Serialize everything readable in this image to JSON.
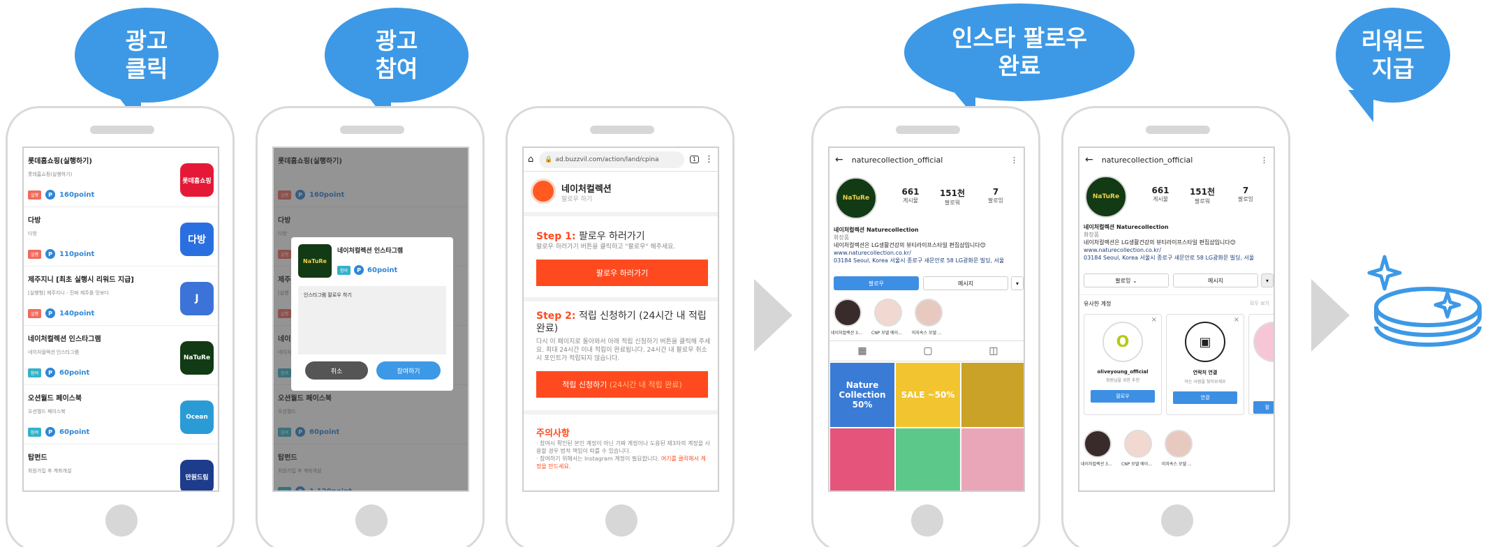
{
  "bubbles": [
    {
      "text": "광고\n클릭"
    },
    {
      "text": "광고\n참여"
    },
    {
      "text": "인스타 팔로우\n완료"
    },
    {
      "text": "리워드\n지급"
    }
  ],
  "colors": {
    "accent": "#3d99e6",
    "orange": "#ff4a1f",
    "point": "#2f86d6",
    "tag_red": "#f06b5d",
    "tag_teal": "#35b1c9"
  },
  "ad_list": [
    {
      "title": "롯데홈쇼핑(실행하기)",
      "sub": "롯데홈쇼핑(실행하기)",
      "tag": "실행",
      "points": "160point",
      "icon_text": "롯데홈쇼핑",
      "icon_color": "#e51937"
    },
    {
      "title": "다방",
      "sub": "다방",
      "tag": "실행",
      "points": "110point",
      "icon_text": "다방",
      "icon_color": "#2a6fe0"
    },
    {
      "title": "제주지니 [최초 실행시 리워드 지급]",
      "sub": "[실행형] 제주지니 - 진짜 제주를 맛보다",
      "tag": "실행",
      "points": "140point",
      "icon_text": "J",
      "icon_color": "#3b73d9"
    },
    {
      "title": "네이처컬렉션 인스타그램",
      "sub": "네이처컬렉션 인스타그램",
      "tag": "참여",
      "points": "60point",
      "icon_text": "NaTuRe",
      "icon_color": "#123a14"
    },
    {
      "title": "오션월드 페이스북",
      "sub": "오션월드 페이스북",
      "tag": "참여",
      "points": "60point",
      "icon_text": "Ocean",
      "icon_color": "#2b9bd6"
    },
    {
      "title": "탑펀드",
      "sub": "회원가입 후 계좌개설",
      "tag": "",
      "points": "",
      "icon_text": "만원드림",
      "icon_color": "#1e3c8c"
    }
  ],
  "phone2": {
    "rows": [
      {
        "title": "롯데홈쇼핑(실행하기)",
        "tag": "실행",
        "points": "160point"
      },
      {
        "title": "다방",
        "sub": "다방",
        "tag": "실행",
        "points": "110point"
      },
      {
        "title": "제주지니",
        "sub": "[실행",
        "tag": "실행",
        "points": "140point"
      },
      {
        "title": "네이처",
        "sub": "네이처",
        "tag": "참여",
        "points": "60point"
      },
      {
        "title": "오션월드 페이스북",
        "sub": "오션월드",
        "tag": "참여",
        "points": "60point"
      },
      {
        "title": "탑펀드",
        "sub": "회원가입 후 계좌개설",
        "tag": "참여",
        "points": "1,120point"
      }
    ],
    "dialog": {
      "title": "네이처컬렉션 인스타그램",
      "tag": "참여",
      "points": "60point",
      "body": "인스타그램 팔로우 하기",
      "cancel": "취소",
      "confirm": "참여하기"
    }
  },
  "phone3": {
    "url": "ad.buzzvil.com/action/land/cpina",
    "tab_count": "1",
    "brand": "네이처컬렉션",
    "brand_sub": "팔로우 하기",
    "step1_label": "Step 1:",
    "step1_title": "팔로우 하러가기",
    "step1_desc": "팔로우 하러가기 버튼을 클릭하고 \"팔로우\" 해주세요.",
    "step1_btn": "팔로우 하러가기",
    "step2_label": "Step 2:",
    "step2_title": "적립 신청하기 (24시간 내 적립 완료)",
    "step2_desc": "다시 이 페이지로 돌아와서 아래 적립 신청하기 버튼을 클릭해 주세요. 최대 24시간 이내 적립이 완료됩니다. 24시간 내 팔로우 취소시 포인트가 적립되지 않습니다.",
    "step2_btn": "적립 신청하기",
    "step2_btn_hint": "(24시간 내 적립 완료)",
    "notice_title": "주의사항",
    "notice_text": "· 참여시 확인된 본인 계정이 아닌 가짜 계정이나 도용된 제3자의 계정을 사용할 경우 법적 책임이 따를 수 있습니다.\n· 참여하기 위해서는 Instagram 계정이 필요합니다.",
    "notice_link": "여기를 클릭해서 계정을 만드세요."
  },
  "ig": {
    "username": "naturecollection_official",
    "avatar_text": "NaTuRe",
    "posts": "661",
    "posts_label": "게시물",
    "followers": "151천",
    "followers_label": "팔로워",
    "following": "7",
    "following_label": "팔로잉",
    "bio_name": "네이처컬렉션 Naturecollection",
    "bio_cat": "화장품",
    "bio_desc": "네이처컬렉션은 LG생활건강의 뷰티라이프스타일 편집샵입니다😊",
    "bio_link": "www.naturecollection.co.kr/",
    "bio_addr": "03184 Seoul, Korea 서울시 종로구 새문안로 58 LG광화문 빌딩, 서울",
    "follow_btn": "팔로우",
    "message_btn": "메시지",
    "stories": [
      "네이처컬렉션 3...",
      "CNP 모델 에이...",
      "미자속스 모델 ..."
    ],
    "tiles": [
      {
        "text": "Nature Collection 50%",
        "color": "#3a7bd5"
      },
      {
        "text": "SALE ~50%",
        "color": "#f2c530"
      },
      {
        "text": "",
        "color": "#c9a227"
      },
      {
        "text": "",
        "color": "#e5547a"
      },
      {
        "text": "",
        "color": "#5cc98a"
      },
      {
        "text": "",
        "color": "#e9a6b8"
      }
    ],
    "following_btn": "팔로잉 ⌄",
    "similar_title": "유사한 계정",
    "see_all": "모두 보기",
    "card1_name": "oliveyoung_official",
    "card1_sub": "회원님을 위한 추천",
    "card1_btn": "팔로우",
    "card2_name": "연락처 연결",
    "card2_sub": "아는 사람을 찾아보세요",
    "card2_btn": "연결",
    "card3_btn": "팔"
  }
}
